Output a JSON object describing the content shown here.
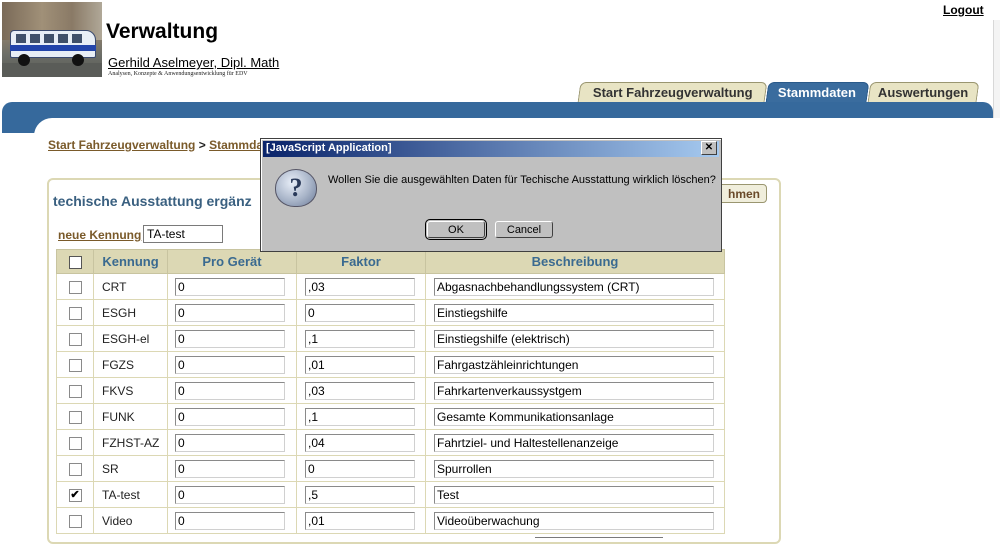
{
  "header": {
    "title": "Verwaltung",
    "author": "Gerhild Aselmeyer, Dipl. Math",
    "tagline": "Analysen, Konzepte & Anwendungsentwicklung für EDV",
    "logout": "Logout"
  },
  "tabs": [
    {
      "label": "Start Fahrzeugverwaltung",
      "active": false
    },
    {
      "label": "Stammdaten",
      "active": true
    },
    {
      "label": "Auswertungen",
      "active": false
    }
  ],
  "breadcrumb": {
    "link1": "Start Fahrzeugverwaltung",
    "sep": ">",
    "link2": "Stammda"
  },
  "panel": {
    "title": "techische Ausstattung ergänz",
    "take_button": "hmen",
    "new_key_label": "neue Kennung",
    "new_key_value": "TA-test"
  },
  "table": {
    "columns": [
      "Kennung",
      "Pro Gerät",
      "Faktor",
      "Beschreibung"
    ],
    "rows": [
      {
        "checked": false,
        "kennung": "CRT",
        "pro": "0",
        "faktor": ",03",
        "beschreibung": "Abgasnachbehandlungssystem (CRT)"
      },
      {
        "checked": false,
        "kennung": "ESGH",
        "pro": "0",
        "faktor": "0",
        "beschreibung": "Einstiegshilfe"
      },
      {
        "checked": false,
        "kennung": "ESGH-el",
        "pro": "0",
        "faktor": ",1",
        "beschreibung": "Einstiegshilfe (elektrisch)"
      },
      {
        "checked": false,
        "kennung": "FGZS",
        "pro": "0",
        "faktor": ",01",
        "beschreibung": "Fahrgastzähleinrichtungen"
      },
      {
        "checked": false,
        "kennung": "FKVS",
        "pro": "0",
        "faktor": ",03",
        "beschreibung": "Fahrkartenverkaussystgem"
      },
      {
        "checked": false,
        "kennung": "FUNK",
        "pro": "0",
        "faktor": ",1",
        "beschreibung": "Gesamte Kommunikationsanlage"
      },
      {
        "checked": false,
        "kennung": "FZHST-AZ",
        "pro": "0",
        "faktor": ",04",
        "beschreibung": "Fahrtziel- und Haltestellenanzeige"
      },
      {
        "checked": false,
        "kennung": "SR",
        "pro": "0",
        "faktor": "0",
        "beschreibung": "Spurrollen"
      },
      {
        "checked": true,
        "kennung": "TA-test",
        "pro": "0",
        "faktor": ",5",
        "beschreibung": "Test"
      },
      {
        "checked": false,
        "kennung": "Video",
        "pro": "0",
        "faktor": ",01",
        "beschreibung": "Videoüberwachung"
      }
    ]
  },
  "dialog": {
    "title": "[JavaScript Application]",
    "message": "Wollen Sie die ausgewählten Daten für Techische Ausstattung wirklich löschen?",
    "ok": "OK",
    "cancel": "Cancel",
    "close_glyph": "✕",
    "icon_glyph": "?"
  },
  "colors": {
    "accent_bar": "#36699c",
    "panel_border": "#dcd8b4",
    "dialog_title": "#0a246a"
  }
}
